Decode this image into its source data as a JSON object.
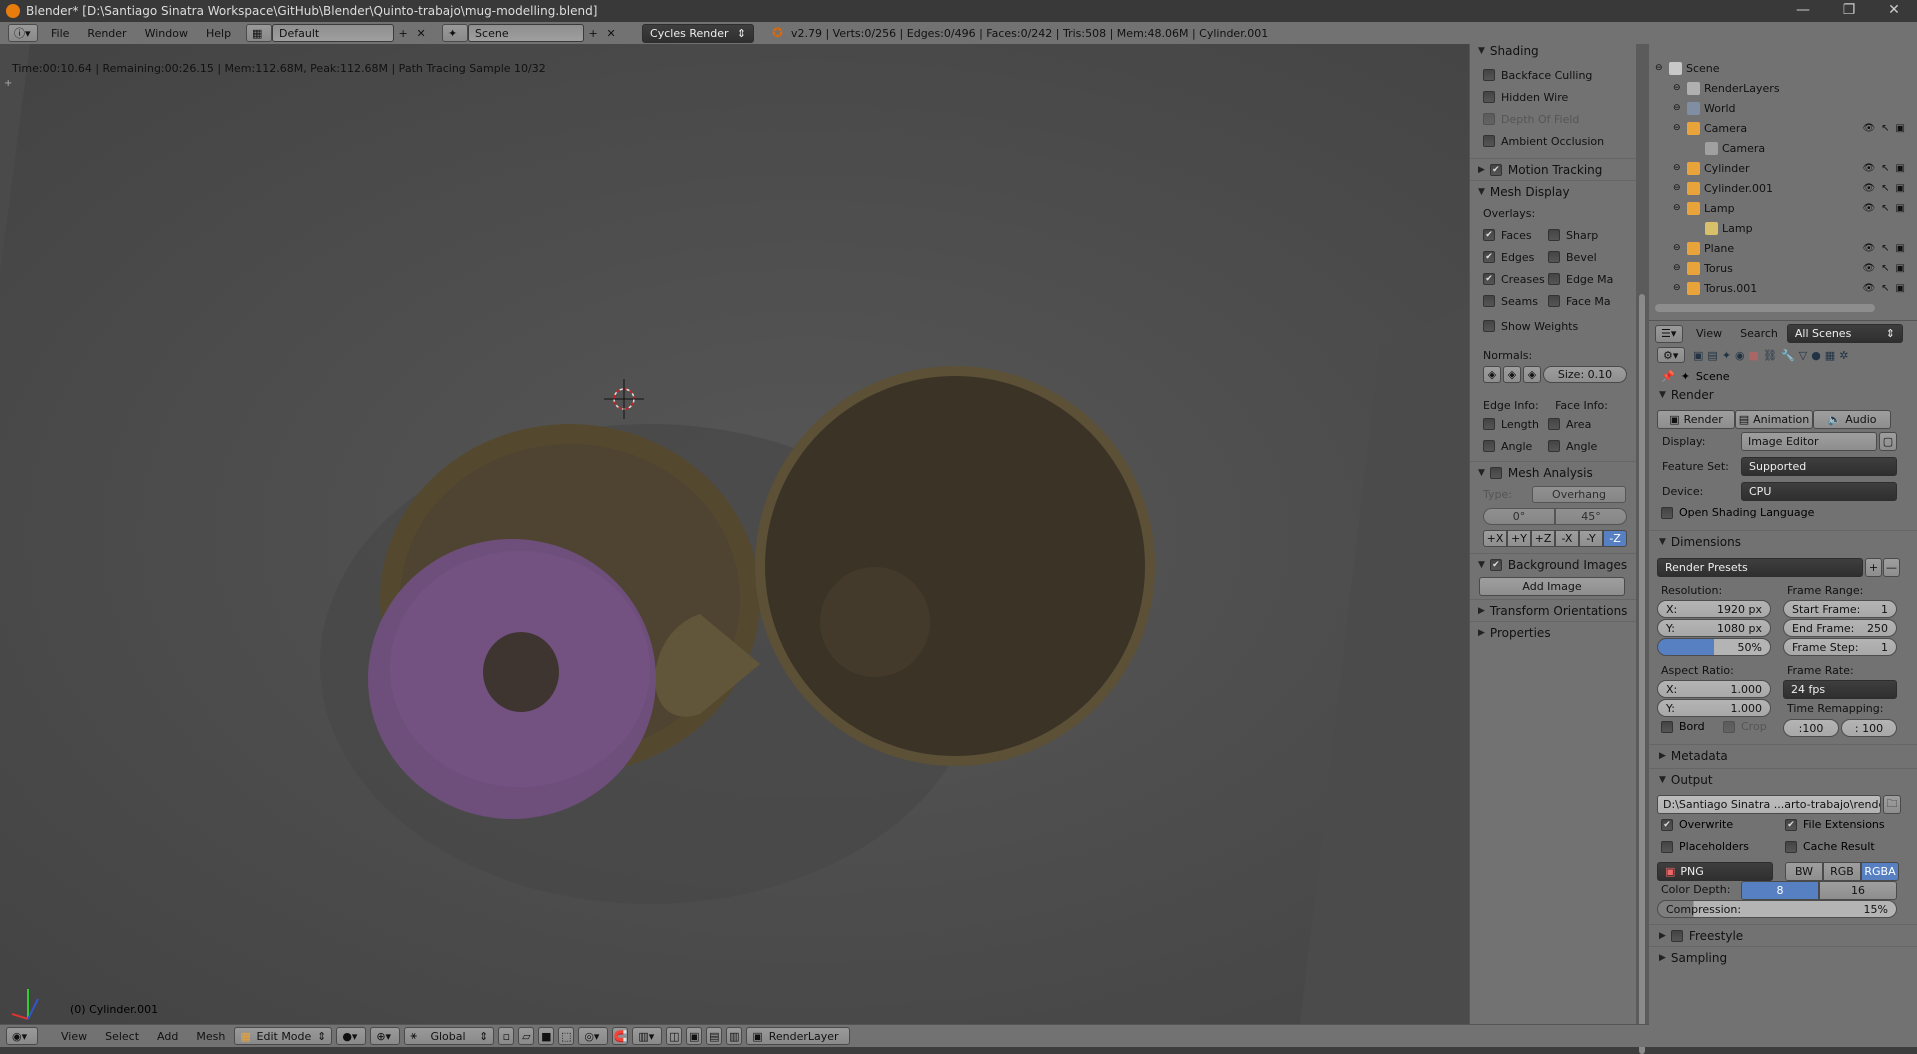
{
  "window": {
    "title": "Blender* [D:\\Santiago Sinatra Workspace\\GitHub\\Blender\\Quinto-trabajo\\mug-modelling.blend]",
    "min": "—",
    "max": "❐",
    "close": "✕"
  },
  "info_header": {
    "menus": [
      "File",
      "Render",
      "Window",
      "Help"
    ],
    "layout": "Default",
    "scene": "Scene",
    "engine": "Cycles Render",
    "stats": "v2.79 | Verts:0/256 | Edges:0/496 | Faces:0/242 | Tris:508 | Mem:48.06M | Cylinder.001"
  },
  "viewport": {
    "status": "Time:00:10.64 | Remaining:00:26.15 | Mem:112.68M, Peak:112.68M | Path Tracing Sample 10/32",
    "object_label": "(0) Cylinder.001",
    "colors": {
      "donut": "#6e4f7c",
      "mug": "#5c5036",
      "plate": "#5a5038"
    }
  },
  "shelf": {
    "shading_title": "Shading",
    "shading_items": [
      {
        "label": "Backface Culling",
        "checked": false,
        "disabled": false
      },
      {
        "label": "Hidden Wire",
        "checked": false,
        "disabled": false
      },
      {
        "label": "Depth Of Field",
        "checked": false,
        "disabled": true
      },
      {
        "label": "Ambient Occlusion",
        "checked": false,
        "disabled": false
      }
    ],
    "motion_tracking": "Motion Tracking",
    "mesh_display": "Mesh Display",
    "overlays_label": "Overlays:",
    "overlays_left": [
      {
        "label": "Faces",
        "checked": true
      },
      {
        "label": "Edges",
        "checked": true
      },
      {
        "label": "Creases",
        "checked": true
      },
      {
        "label": "Seams",
        "checked": false
      }
    ],
    "overlays_right": [
      {
        "label": "Sharp",
        "checked": false
      },
      {
        "label": "Bevel",
        "checked": false
      },
      {
        "label": "Edge Ma",
        "checked": false
      },
      {
        "label": "Face Ma",
        "checked": false
      }
    ],
    "show_weights": "Show Weights",
    "normals_label": "Normals:",
    "normals_size": "Size:  0.10",
    "edge_info": "Edge Info:",
    "face_info": "Face Info:",
    "edge_length": "Length",
    "edge_angle": "Angle",
    "face_area": "Area",
    "face_angle": "Angle",
    "mesh_analysis": "Mesh Analysis",
    "type_label": "Type:",
    "type_value": "Overhang",
    "angle_min": "0°",
    "angle_max": "45°",
    "axes": [
      "+X",
      "+Y",
      "+Z",
      "-X",
      "-Y",
      "-Z"
    ],
    "background_images": "Background Images",
    "add_image": "Add Image",
    "transform_orientations": "Transform Orientations",
    "properties": "Properties"
  },
  "outliner": {
    "items": [
      {
        "label": "Scene",
        "indent": 0,
        "icon": "scene-icon",
        "color": "#c8c8c8"
      },
      {
        "label": "RenderLayers",
        "indent": 1,
        "icon": "renderlayers-icon",
        "color": "#b0b0b0"
      },
      {
        "label": "World",
        "indent": 1,
        "icon": "world-icon",
        "color": "#7f8ea2"
      },
      {
        "label": "Camera",
        "indent": 1,
        "icon": "camera-icon",
        "color": "#e8a33a"
      },
      {
        "label": "Camera",
        "indent": 2,
        "icon": "camera-data-icon",
        "color": "#a0a0a0"
      },
      {
        "label": "Cylinder",
        "indent": 1,
        "icon": "mesh-icon",
        "color": "#e8a33a"
      },
      {
        "label": "Cylinder.001",
        "indent": 1,
        "icon": "mesh-icon",
        "color": "#e8a33a"
      },
      {
        "label": "Lamp",
        "indent": 1,
        "icon": "lamp-icon",
        "color": "#e8a33a"
      },
      {
        "label": "Lamp",
        "indent": 2,
        "icon": "lamp-data-icon",
        "color": "#d8c06a"
      },
      {
        "label": "Plane",
        "indent": 1,
        "icon": "mesh-icon",
        "color": "#e8a33a"
      },
      {
        "label": "Torus",
        "indent": 1,
        "icon": "mesh-icon",
        "color": "#e8a33a"
      },
      {
        "label": "Torus.001",
        "indent": 1,
        "icon": "mesh-icon",
        "color": "#e8a33a"
      }
    ],
    "view": "View",
    "search": "Search",
    "filter": "All Scenes"
  },
  "properties": {
    "context": "Scene",
    "render_title": "Render",
    "render_btn": "Render",
    "animation_btn": "Animation",
    "audio_btn": "Audio",
    "display_label": "Display:",
    "display_value": "Image Editor",
    "feature_label": "Feature Set:",
    "feature_value": "Supported",
    "device_label": "Device:",
    "device_value": "CPU",
    "osl": "Open Shading Language",
    "dimensions_title": "Dimensions",
    "render_presets": "Render Presets",
    "resolution_label": "Resolution:",
    "res_x_label": "X:",
    "res_x": "1920 px",
    "res_y_label": "Y:",
    "res_y": "1080 px",
    "res_pct": "50%",
    "frame_range_label": "Frame Range:",
    "start_label": "Start Frame:",
    "start": "1",
    "end_label": "End Frame:",
    "end": "250",
    "step_label": "Frame Step:",
    "step": "1",
    "aspect_label": "Aspect Ratio:",
    "asp_x_label": "X:",
    "asp_x": "1.000",
    "asp_y_label": "Y:",
    "asp_y": "1.000",
    "frame_rate_label": "Frame Rate:",
    "frame_rate": "24 fps",
    "time_remap_label": "Time Remapping:",
    "remap_old": ":100",
    "remap_new": ": 100",
    "bord": "Bord",
    "crop": "Crop",
    "metadata_title": "Metadata",
    "output_title": "Output",
    "output_path": "D:\\Santiago Sinatra ...arto-trabajo\\render\\",
    "overwrite": "Overwrite",
    "file_ext": "File Extensions",
    "placeholders": "Placeholders",
    "cache_result": "Cache Result",
    "format": "PNG",
    "bw": "BW",
    "rgb": "RGB",
    "rgba": "RGBA",
    "color_depth_label": "Color Depth:",
    "depth_8": "8",
    "depth_16": "16",
    "compression_label": "Compression:",
    "compression": "15%",
    "freestyle": "Freestyle",
    "sampling": "Sampling"
  },
  "bottom_header": {
    "menus": [
      "View",
      "Select",
      "Add",
      "Mesh"
    ],
    "mode": "Edit Mode",
    "orientation": "Global",
    "render_layer": "RenderLayer"
  }
}
